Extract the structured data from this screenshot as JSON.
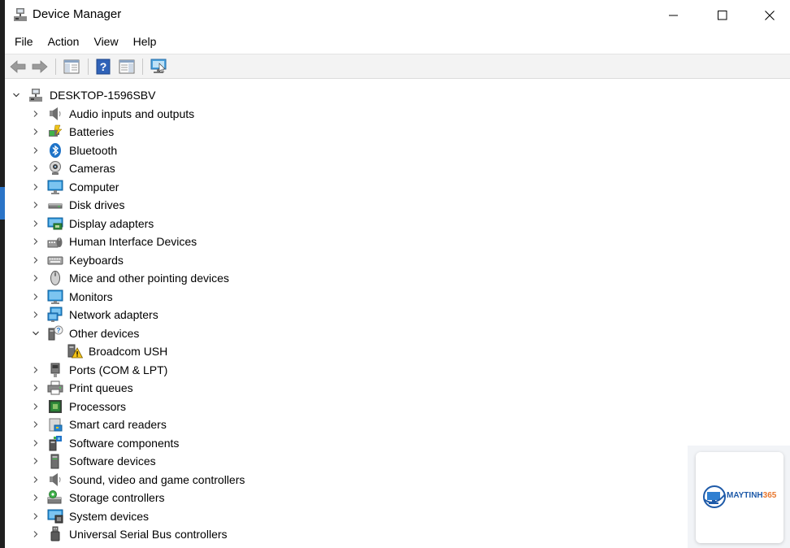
{
  "window": {
    "title": "Device Manager"
  },
  "menu": [
    "File",
    "Action",
    "View",
    "Help"
  ],
  "toolbar": {
    "buttons": [
      "back-icon",
      "forward-icon",
      "show-hide-tree-icon",
      "help-icon",
      "properties-icon",
      "scan-hardware-icon"
    ]
  },
  "tree": {
    "root": "DESKTOP-1596SBV",
    "categories": [
      {
        "label": "Audio inputs and outputs",
        "icon": "speaker-icon",
        "expanded": false
      },
      {
        "label": "Batteries",
        "icon": "battery-icon",
        "expanded": false
      },
      {
        "label": "Bluetooth",
        "icon": "bluetooth-icon",
        "expanded": false
      },
      {
        "label": "Cameras",
        "icon": "camera-icon",
        "expanded": false
      },
      {
        "label": "Computer",
        "icon": "computer-icon",
        "expanded": false
      },
      {
        "label": "Disk drives",
        "icon": "disk-drive-icon",
        "expanded": false
      },
      {
        "label": "Display adapters",
        "icon": "display-adapter-icon",
        "expanded": false
      },
      {
        "label": "Human Interface Devices",
        "icon": "hid-icon",
        "expanded": false
      },
      {
        "label": "Keyboards",
        "icon": "keyboard-icon",
        "expanded": false
      },
      {
        "label": "Mice and other pointing devices",
        "icon": "mouse-icon",
        "expanded": false
      },
      {
        "label": "Monitors",
        "icon": "monitor-icon",
        "expanded": false
      },
      {
        "label": "Network adapters",
        "icon": "network-adapter-icon",
        "expanded": false
      },
      {
        "label": "Other devices",
        "icon": "unknown-device-icon",
        "expanded": true,
        "children": [
          {
            "label": "Broadcom USH",
            "icon": "warning-device-icon"
          }
        ]
      },
      {
        "label": "Ports (COM & LPT)",
        "icon": "port-icon",
        "expanded": false
      },
      {
        "label": "Print queues",
        "icon": "printer-icon",
        "expanded": false
      },
      {
        "label": "Processors",
        "icon": "processor-icon",
        "expanded": false
      },
      {
        "label": "Smart card readers",
        "icon": "smart-card-reader-icon",
        "expanded": false
      },
      {
        "label": "Software components",
        "icon": "software-component-icon",
        "expanded": false
      },
      {
        "label": "Software devices",
        "icon": "software-device-icon",
        "expanded": false
      },
      {
        "label": "Sound, video and game controllers",
        "icon": "sound-controller-icon",
        "expanded": false
      },
      {
        "label": "Storage controllers",
        "icon": "storage-controller-icon",
        "expanded": false
      },
      {
        "label": "System devices",
        "icon": "system-device-icon",
        "expanded": false
      },
      {
        "label": "Universal Serial Bus controllers",
        "icon": "usb-icon",
        "expanded": false
      }
    ]
  },
  "watermark": {
    "brand_main": "MAYTINH",
    "brand_accent": "365"
  },
  "colors": {
    "accent_blue": "#1e73c8",
    "warning_yellow": "#f5c518",
    "brand_blue": "#1e5aa8",
    "brand_orange": "#e8772e"
  }
}
